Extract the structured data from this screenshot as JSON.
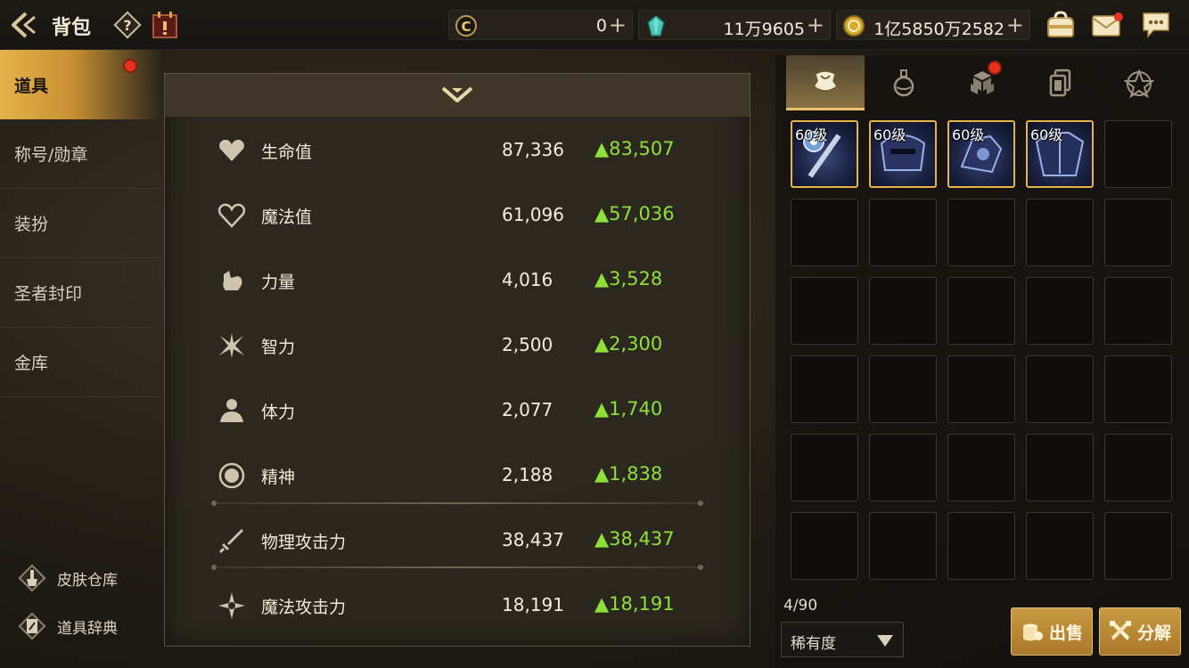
{
  "header": {
    "title": "背包",
    "currencies": [
      {
        "icon": "coin-c-icon",
        "value": "0"
      },
      {
        "icon": "crystal-icon",
        "value": "11万9605"
      },
      {
        "icon": "gold-coin-icon",
        "value": "1亿5850万2582"
      }
    ],
    "plus": "+"
  },
  "sidebar": {
    "items": [
      {
        "label": "道具",
        "active": true,
        "badge": true
      },
      {
        "label": "称号/勋章"
      },
      {
        "label": "装扮"
      },
      {
        "label": "圣者封印"
      },
      {
        "label": "金库"
      }
    ],
    "links": [
      {
        "label": "皮肤仓库",
        "icon": "brush-icon"
      },
      {
        "label": "道具辞典",
        "icon": "book-icon"
      }
    ]
  },
  "stats": {
    "rows": [
      {
        "icon": "heart-icon",
        "label": "生命值",
        "value": "87,336",
        "delta": "▲83,507"
      },
      {
        "icon": "heart-outline-icon",
        "label": "魔法值",
        "value": "61,096",
        "delta": "▲57,036"
      },
      {
        "icon": "fist-icon",
        "label": "力量",
        "value": "4,016",
        "delta": "▲3,528"
      },
      {
        "icon": "spark-icon",
        "label": "智力",
        "value": "2,500",
        "delta": "▲2,300"
      },
      {
        "icon": "body-icon",
        "label": "体力",
        "value": "2,077",
        "delta": "▲1,740"
      },
      {
        "icon": "orb-icon",
        "label": "精神",
        "value": "2,188",
        "delta": "▲1,838"
      },
      {
        "icon": "sword-icon",
        "label": "物理攻击力",
        "value": "38,437",
        "delta": "▲38,437"
      },
      {
        "icon": "magic-star-icon",
        "label": "魔法攻击力",
        "value": "18,191",
        "delta": "▲18,191"
      }
    ]
  },
  "inventory": {
    "tabs": [
      {
        "icon": "armor-icon",
        "active": true
      },
      {
        "icon": "potion-icon"
      },
      {
        "icon": "material-cubes-icon",
        "badge": true
      },
      {
        "icon": "cards-icon"
      },
      {
        "icon": "pentagram-icon"
      }
    ],
    "items": [
      {
        "level": "60级",
        "icon": "staff-item-icon"
      },
      {
        "level": "60级",
        "icon": "helmet-item-icon"
      },
      {
        "level": "60级",
        "icon": "gauntlet-item-icon"
      },
      {
        "level": "60级",
        "icon": "armor-item-icon"
      }
    ],
    "count": "4/90",
    "sort_label": "稀有度",
    "sell_label": "出售",
    "dismantle_label": "分解"
  },
  "colors": {
    "accent_gold": "#e5b34a",
    "delta_green": "#8fe03a",
    "badge_red": "#e8321f"
  }
}
